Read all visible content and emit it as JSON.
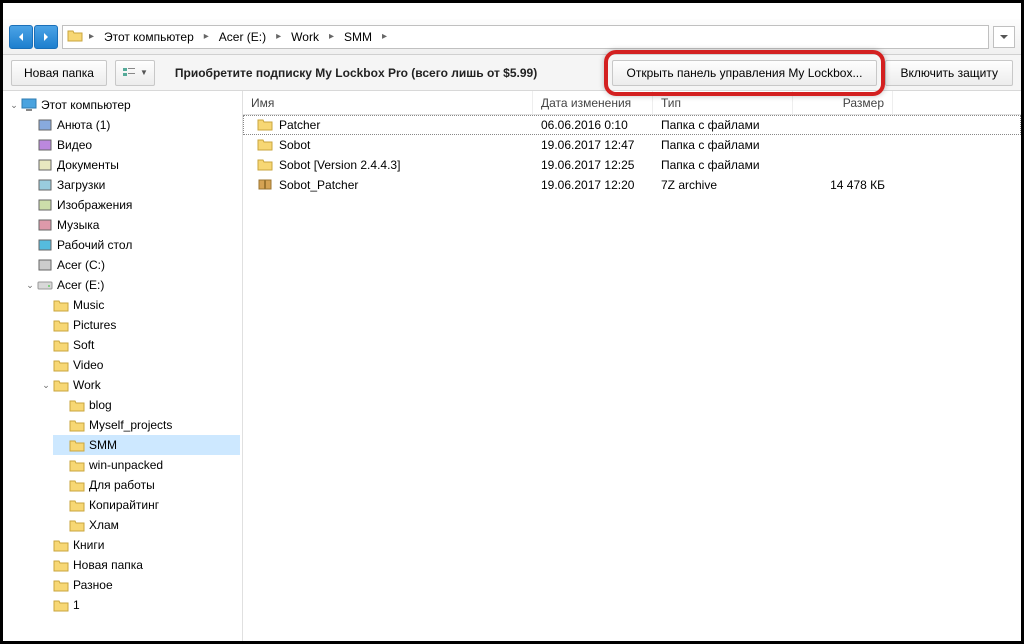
{
  "breadcrumbs": [
    "Этот компьютер",
    "Acer (E:)",
    "Work",
    "SMM"
  ],
  "toolbar": {
    "new_folder": "Новая папка",
    "promo": "Приобретите подписку My Lockbox Pro (всего лишь от $5.99)",
    "open_panel": "Открыть панель управления My Lockbox...",
    "enable_protect": "Включить защиту"
  },
  "tree": {
    "root": "Этот компьютер",
    "items": [
      "Анюта (1)",
      "Видео",
      "Документы",
      "Загрузки",
      "Изображения",
      "Музыка",
      "Рабочий стол",
      "Acer (C:)"
    ],
    "drive": "Acer (E:)",
    "drive_items": [
      "Music",
      "Pictures",
      "Soft",
      "Video"
    ],
    "work": "Work",
    "work_items": [
      "blog",
      "Myself_projects",
      "SMM",
      "win-unpacked",
      "Для работы",
      "Копирайтинг",
      "Хлам"
    ],
    "after_work": [
      "Книги",
      "Новая папка",
      "Разное",
      "1"
    ]
  },
  "columns": {
    "name": "Имя",
    "date": "Дата изменения",
    "type": "Тип",
    "size": "Размер"
  },
  "rows": [
    {
      "name": "Patcher",
      "date": "06.06.2016 0:10",
      "type": "Папка с файлами",
      "size": "",
      "icon": "folder"
    },
    {
      "name": "Sobot",
      "date": "19.06.2017 12:47",
      "type": "Папка с файлами",
      "size": "",
      "icon": "folder"
    },
    {
      "name": "Sobot [Version 2.4.4.3]",
      "date": "19.06.2017 12:25",
      "type": "Папка с файлами",
      "size": "",
      "icon": "folder"
    },
    {
      "name": "Sobot_Patcher",
      "date": "19.06.2017 12:20",
      "type": "7Z archive",
      "size": "14 478 КБ",
      "icon": "archive"
    }
  ]
}
